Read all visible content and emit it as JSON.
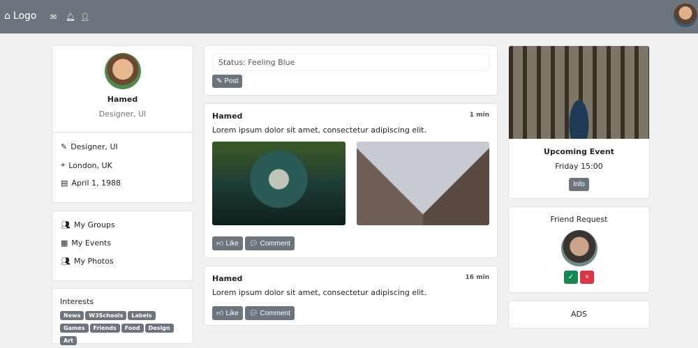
{
  "nav": {
    "logo": "Logo"
  },
  "profile": {
    "name": "Hamed",
    "role": "Designer, UI"
  },
  "info": [
    {
      "icon": "pencil-icon",
      "text": "Designer, UI"
    },
    {
      "icon": "location-icon",
      "text": "London, UK"
    },
    {
      "icon": "cake-icon",
      "text": "April 1, 1988"
    }
  ],
  "links": [
    {
      "icon": "people-icon",
      "text": "My Groups"
    },
    {
      "icon": "calendar-icon",
      "text": "My Events"
    },
    {
      "icon": "people-icon",
      "text": "My Photos"
    }
  ],
  "interests": {
    "title": "Interests",
    "tags": [
      "News",
      "W3Schools",
      "Labels",
      "Games",
      "Friends",
      "Food",
      "Design",
      "Art"
    ]
  },
  "status": {
    "value": "Status: Feeling Blue",
    "post_label": "Post"
  },
  "posts": [
    {
      "author": "Hamed",
      "time": "1 min",
      "text": "Lorem ipsum dolor sit amet, consectetur adipiscing elit.",
      "like": "Like",
      "comment": "Comment"
    },
    {
      "author": "Hamed",
      "time": "16 min",
      "text": "Lorem ipsum dolor sit amet, consectetur adipiscing elit.",
      "like": "Like",
      "comment": "Comment"
    }
  ],
  "event": {
    "title": "Upcoming Event",
    "time": "Friday 15:00",
    "info_label": "Info"
  },
  "friend": {
    "title": "Friend Request",
    "accept": "✓",
    "decline": "×"
  },
  "ads": {
    "title": "ADS"
  },
  "colors": {
    "nav": "#6c757d",
    "accept": "#198754",
    "decline": "#dc3545"
  }
}
